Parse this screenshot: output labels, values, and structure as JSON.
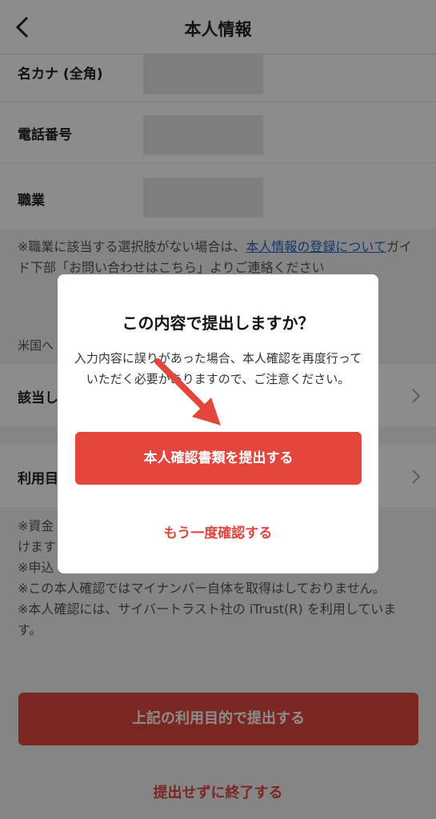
{
  "header": {
    "title": "本人情報"
  },
  "form": {
    "rows": [
      {
        "label": "名カナ (全角)"
      },
      {
        "label": "電話番号"
      },
      {
        "label": "職業"
      }
    ]
  },
  "note_occupation": {
    "prefix": "※職業に該当する選択肢がない場合は、",
    "link": "本人情報の登録について",
    "suffix": "ガイド下部「お問い合わせはこちら」よりご連絡ください"
  },
  "us_text": "米国へ",
  "selects": [
    {
      "label": "該当し"
    },
    {
      "label": "利用目"
    }
  ],
  "notes_bottom": [
    "※資金",
    "けます",
    "※申込",
    "※この本人確認ではマイナンバー自体を取得はしておりません。",
    "※本人確認には、サイバートラスト社の iTrust(R) を利用しています。"
  ],
  "bg_submit_label": "上記の利用目的で提出する",
  "exit_label": "提出せずに終了する",
  "dialog": {
    "title": "この内容で提出しますか？",
    "message": "入力内容に誤りがあった場合、本人確認を再度行っていただく必要がありますので、ご注意ください。",
    "submit_label": "本人確認書類を提出する",
    "recheck_label": "もう一度確認する"
  },
  "colors": {
    "accent": "#e2463d",
    "link": "#2a63c6",
    "overlay": "rgba(0,0,0,0.45)"
  }
}
